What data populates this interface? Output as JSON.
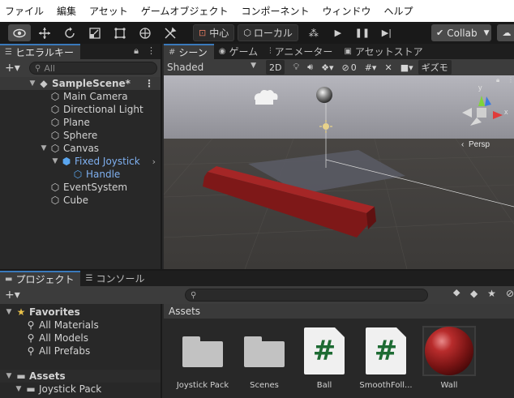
{
  "menubar": {
    "items": [
      "ファイル",
      "編集",
      "アセット",
      "ゲームオブジェクト",
      "コンポーネント",
      "ウィンドウ",
      "ヘルプ"
    ]
  },
  "toolbar": {
    "tools": [
      "view-tool-icon",
      "move-tool-icon",
      "rotate-tool-icon",
      "scale-tool-icon",
      "rect-tool-icon",
      "transform-tool-icon",
      "custom-tool-icon"
    ],
    "pivot_label": "中心",
    "space_label": "ローカル",
    "collab_label": "Collab"
  },
  "hierarchy": {
    "tab_label": "ヒエラルキー",
    "search_placeholder": "All",
    "scene_name": "SampleScene*",
    "items": [
      {
        "label": "Main Camera"
      },
      {
        "label": "Directional Light"
      },
      {
        "label": "Plane"
      },
      {
        "label": "Sphere"
      },
      {
        "label": "Canvas"
      },
      {
        "label": "Fixed Joystick"
      },
      {
        "label": "Handle"
      },
      {
        "label": "EventSystem"
      },
      {
        "label": "Cube"
      }
    ]
  },
  "scene": {
    "tabs": [
      "シーン",
      "ゲーム",
      "アニメーター",
      "アセットストア"
    ],
    "shading_mode": "Shaded",
    "toggle_2d": "2D",
    "hidden_count": "0",
    "gizmos_label": "ギズモ",
    "gizmo_axes": {
      "y": "y",
      "x": "x"
    },
    "persp_label": "Persp"
  },
  "project": {
    "tabs": [
      "プロジェクト",
      "コンソール"
    ],
    "favorites": {
      "label": "Favorites",
      "items": [
        "All Materials",
        "All Models",
        "All Prefabs"
      ]
    },
    "assets_tree": {
      "label": "Assets",
      "children": [
        "Joystick Pack"
      ]
    },
    "assets_header": "Assets",
    "assets": [
      {
        "name": "Joystick Pack",
        "kind": "folder"
      },
      {
        "name": "Scenes",
        "kind": "folder"
      },
      {
        "name": "Ball",
        "kind": "script"
      },
      {
        "name": "SmoothFoll...",
        "kind": "script"
      },
      {
        "name": "Wall",
        "kind": "material"
      }
    ]
  },
  "colors": {
    "selected_text": "#7fb0f0",
    "wall": "#8b1c1c",
    "script_hash": "#1d6b33",
    "tab_accent": "#3a79bb"
  }
}
